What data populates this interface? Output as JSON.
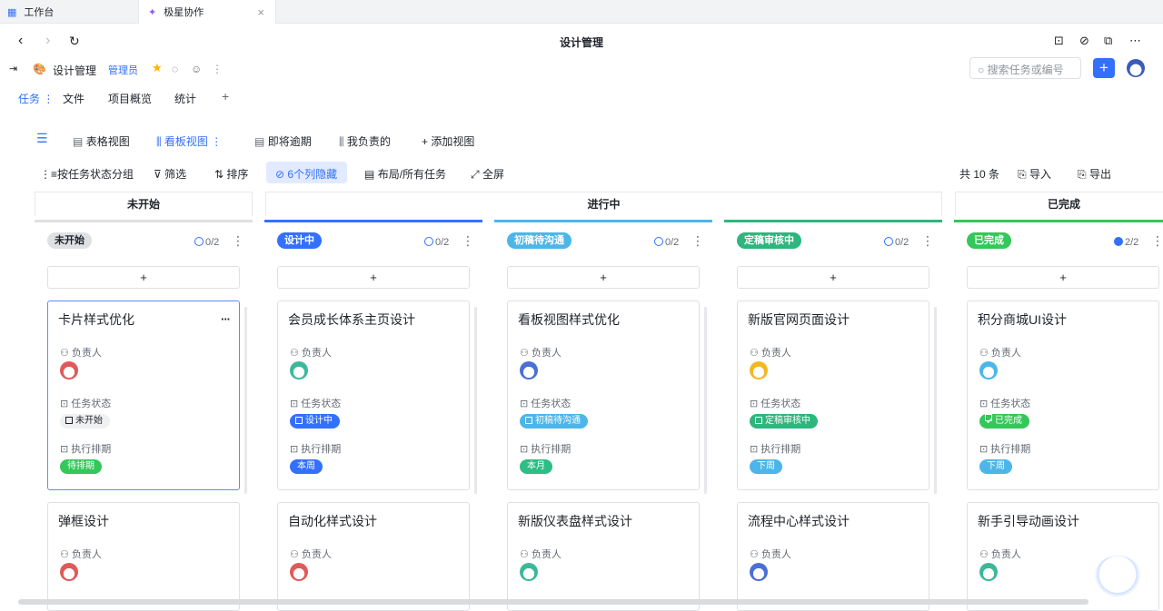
{
  "browser_tabs": [
    {
      "label": "工作台"
    },
    {
      "label": "极星协作"
    }
  ],
  "nav": {
    "title": "设计管理"
  },
  "project": {
    "name": "设计管理",
    "role_badge": "管理员"
  },
  "search": {
    "placeholder": "搜索任务或编号"
  },
  "main_tabs": [
    {
      "label": "任务"
    },
    {
      "label": "文件"
    },
    {
      "label": "项目概览"
    },
    {
      "label": "统计"
    }
  ],
  "views": [
    {
      "label": "表格视图"
    },
    {
      "label": "看板视图"
    },
    {
      "label": "即将逾期"
    },
    {
      "label": "我负责的"
    },
    {
      "label": "添加视图"
    }
  ],
  "toolbar": {
    "group_by": "按任务状态分组",
    "filter": "筛选",
    "sort": "排序",
    "hidden_cols": "6个列隐藏",
    "layout": "布局/所有任务",
    "fullscreen": "全屏",
    "count": "共 10 条",
    "import": "导入",
    "export": "导出"
  },
  "groups": [
    {
      "label": "未开始"
    },
    {
      "label": "进行中"
    },
    {
      "label": "已完成"
    }
  ],
  "field_labels": {
    "owner": "负责人",
    "status": "任务状态",
    "schedule": "执行排期"
  },
  "columns": [
    {
      "name": "未开始",
      "progress": "0/2",
      "color": "#dee0e3",
      "text": "#1f2329",
      "cards": [
        {
          "title": "卡片样式优化",
          "status": "未开始",
          "schedule": "待排期",
          "sched_color": "#34c759"
        },
        {
          "title": "弹框设计"
        }
      ]
    },
    {
      "name": "设计中",
      "progress": "0/2",
      "color": "#3370ff",
      "text": "#ffffff",
      "cards": [
        {
          "title": "会员成长体系主页设计",
          "status": "设计中",
          "schedule": "本周",
          "sched_color": "#3370ff"
        },
        {
          "title": "自动化样式设计"
        }
      ]
    },
    {
      "name": "初稿待沟通",
      "progress": "0/2",
      "color": "#4cb6e8",
      "text": "#ffffff",
      "cards": [
        {
          "title": "看板视图样式优化",
          "status": "初稿待沟通",
          "schedule": "本月",
          "sched_color": "#2ebd85"
        },
        {
          "title": "新版仪表盘样式设计"
        }
      ]
    },
    {
      "name": "定稿审核中",
      "progress": "0/2",
      "color": "#2db67d",
      "text": "#ffffff",
      "cards": [
        {
          "title": "新版官网页面设计",
          "status": "定稿审核中",
          "schedule": "下周",
          "sched_color": "#4cb6e8"
        },
        {
          "title": "流程中心样式设计"
        }
      ]
    },
    {
      "name": "已完成",
      "progress": "2/2",
      "color": "#34c759",
      "text": "#ffffff",
      "cards": [
        {
          "title": "积分商城UI设计",
          "status": "已完成",
          "schedule": "下周",
          "sched_color": "#4cb6e8"
        },
        {
          "title": "新手引导动画设计"
        }
      ]
    }
  ]
}
